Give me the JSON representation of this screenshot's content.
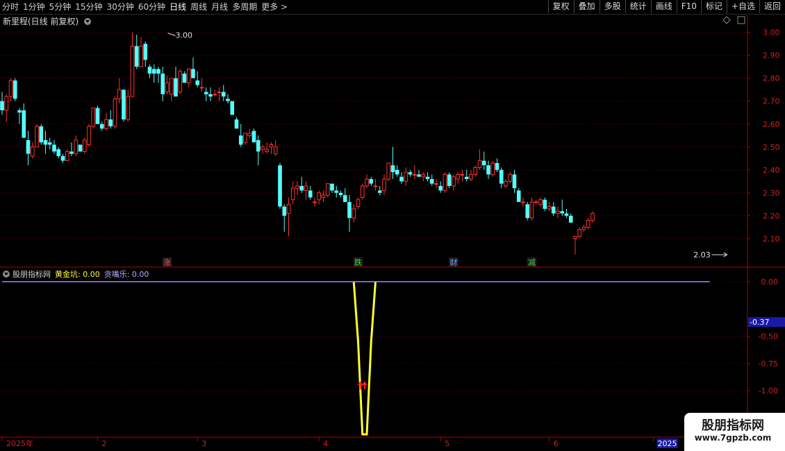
{
  "toolbar": {
    "periods": [
      "分时",
      "1分钟",
      "5分钟",
      "15分钟",
      "30分钟",
      "60分钟",
      "日线",
      "周线",
      "月线",
      "多周期",
      "更多"
    ],
    "active_period": "日线",
    "actions": [
      "复权",
      "叠加",
      "多股",
      "统计",
      "画线",
      "F10",
      "标记",
      "+自选",
      "返回"
    ]
  },
  "main_panel": {
    "title": "新里程(日线 前复权)"
  },
  "indicator_panel": {
    "name": "股朋指标网",
    "series1": "黄金坑: 0.00",
    "series2": "贪嘴乐: 0.00"
  },
  "colors": {
    "up": "#ff3232",
    "down": "#54ffff",
    "grid": "#7a0000",
    "axis": "#b00000",
    "line1": "#ffff33",
    "line2": "#9d8cff",
    "arrow": "#ff2020"
  },
  "chart_data": [
    {
      "type": "candlestick",
      "price_labels": [
        "3.00",
        "2.90",
        "2.80",
        "2.70",
        "2.60",
        "2.50",
        "2.40",
        "2.30",
        "2.20",
        "2.10"
      ],
      "ylim": [
        2.0,
        3.02
      ],
      "annotations": [
        {
          "text": "3.00",
          "index": 38,
          "price": 3.0
        },
        {
          "text": "2.03",
          "index": 167,
          "price": 2.03
        }
      ],
      "event_markers": [
        {
          "text": "涨",
          "index": 38,
          "color": "#ff5050"
        },
        {
          "text": "跌",
          "index": 82,
          "color": "#3fd43f"
        },
        {
          "text": "财",
          "index": 104,
          "color": "#6fa8ff"
        },
        {
          "text": "减",
          "index": 122,
          "color": "#3fd43f"
        }
      ],
      "ohlc": [
        [
          2.7,
          2.74,
          2.64,
          2.66
        ],
        [
          2.66,
          2.73,
          2.61,
          2.72
        ],
        [
          2.72,
          2.8,
          2.7,
          2.79
        ],
        [
          2.79,
          2.8,
          2.7,
          2.71
        ],
        [
          2.66,
          2.67,
          2.6,
          2.65
        ],
        [
          2.66,
          2.69,
          2.54,
          2.54
        ],
        [
          2.53,
          2.57,
          2.42,
          2.47
        ],
        [
          2.46,
          2.52,
          2.45,
          2.5
        ],
        [
          2.5,
          2.6,
          2.5,
          2.59
        ],
        [
          2.59,
          2.6,
          2.51,
          2.52
        ],
        [
          2.53,
          2.57,
          2.47,
          2.51
        ],
        [
          2.52,
          2.54,
          2.49,
          2.51
        ],
        [
          2.51,
          2.53,
          2.47,
          2.48
        ],
        [
          2.49,
          2.5,
          2.45,
          2.46
        ],
        [
          2.46,
          2.47,
          2.43,
          2.44
        ],
        [
          2.44,
          2.49,
          2.44,
          2.48
        ],
        [
          2.48,
          2.52,
          2.46,
          2.47
        ],
        [
          2.47,
          2.55,
          2.46,
          2.53
        ],
        [
          2.51,
          2.51,
          2.48,
          2.48
        ],
        [
          2.48,
          2.54,
          2.47,
          2.53
        ],
        [
          2.51,
          2.6,
          2.5,
          2.59
        ],
        [
          2.59,
          2.66,
          2.58,
          2.67
        ],
        [
          2.67,
          2.68,
          2.6,
          2.6
        ],
        [
          2.6,
          2.61,
          2.57,
          2.58
        ],
        [
          2.58,
          2.65,
          2.57,
          2.62
        ],
        [
          2.62,
          2.66,
          2.58,
          2.59
        ],
        [
          2.59,
          2.72,
          2.58,
          2.71
        ],
        [
          2.71,
          2.8,
          2.69,
          2.75
        ],
        [
          2.75,
          2.75,
          2.61,
          2.62
        ],
        [
          2.62,
          2.75,
          2.61,
          2.72
        ],
        [
          2.72,
          3.0,
          2.72,
          2.94
        ],
        [
          2.94,
          2.99,
          2.84,
          2.85
        ],
        [
          2.85,
          2.98,
          2.85,
          2.94
        ],
        [
          2.95,
          2.96,
          2.85,
          2.88
        ],
        [
          2.85,
          2.86,
          2.8,
          2.82
        ],
        [
          2.84,
          2.86,
          2.78,
          2.82
        ],
        [
          2.84,
          2.85,
          2.78,
          2.82
        ],
        [
          2.82,
          2.85,
          2.7,
          2.73
        ],
        [
          2.74,
          2.81,
          2.73,
          2.78
        ],
        [
          2.73,
          2.8,
          2.7,
          2.8
        ],
        [
          2.8,
          2.85,
          2.72,
          2.72
        ],
        [
          2.74,
          2.84,
          2.73,
          2.83
        ],
        [
          2.82,
          2.83,
          2.78,
          2.78
        ],
        [
          2.78,
          2.84,
          2.76,
          2.84
        ],
        [
          2.84,
          2.89,
          2.8,
          2.8
        ],
        [
          2.79,
          2.83,
          2.76,
          2.77
        ],
        [
          2.76,
          2.8,
          2.74,
          2.76
        ],
        [
          2.74,
          2.76,
          2.7,
          2.73
        ],
        [
          2.73,
          2.76,
          2.7,
          2.72
        ],
        [
          2.73,
          2.75,
          2.72,
          2.73
        ],
        [
          2.74,
          2.76,
          2.7,
          2.74
        ],
        [
          2.74,
          2.77,
          2.7,
          2.72
        ],
        [
          2.71,
          2.73,
          2.69,
          2.7
        ],
        [
          2.7,
          2.7,
          2.64,
          2.64
        ],
        [
          2.62,
          2.63,
          2.58,
          2.58
        ],
        [
          2.55,
          2.6,
          2.5,
          2.51
        ],
        [
          2.52,
          2.56,
          2.51,
          2.56
        ],
        [
          2.55,
          2.58,
          2.54,
          2.56
        ],
        [
          2.57,
          2.58,
          2.52,
          2.52
        ],
        [
          2.53,
          2.55,
          2.42,
          2.48
        ],
        [
          2.49,
          2.51,
          2.47,
          2.5
        ],
        [
          2.48,
          2.52,
          2.47,
          2.49
        ],
        [
          2.5,
          2.52,
          2.47,
          2.51
        ],
        [
          2.47,
          2.53,
          2.46,
          2.5
        ],
        [
          2.42,
          2.43,
          2.23,
          2.24
        ],
        [
          2.24,
          2.25,
          2.13,
          2.2
        ],
        [
          2.21,
          2.28,
          2.11,
          2.25
        ],
        [
          2.27,
          2.35,
          2.25,
          2.32
        ],
        [
          2.32,
          2.35,
          2.29,
          2.33
        ],
        [
          2.33,
          2.37,
          2.3,
          2.31
        ],
        [
          2.31,
          2.35,
          2.27,
          2.33
        ],
        [
          2.31,
          2.33,
          2.27,
          2.28
        ],
        [
          2.26,
          2.28,
          2.24,
          2.26
        ],
        [
          2.27,
          2.31,
          2.25,
          2.3
        ],
        [
          2.28,
          2.31,
          2.26,
          2.29
        ],
        [
          2.29,
          2.34,
          2.28,
          2.34
        ],
        [
          2.34,
          2.34,
          2.3,
          2.31
        ],
        [
          2.31,
          2.33,
          2.28,
          2.3
        ],
        [
          2.3,
          2.31,
          2.28,
          2.29
        ],
        [
          2.29,
          2.32,
          2.26,
          2.26
        ],
        [
          2.26,
          2.29,
          2.13,
          2.19
        ],
        [
          2.19,
          2.25,
          2.17,
          2.23
        ],
        [
          2.24,
          2.28,
          2.23,
          2.27
        ],
        [
          2.28,
          2.34,
          2.27,
          2.33
        ],
        [
          2.33,
          2.38,
          2.32,
          2.36
        ],
        [
          2.36,
          2.37,
          2.33,
          2.34
        ],
        [
          2.33,
          2.36,
          2.31,
          2.33
        ],
        [
          2.31,
          2.33,
          2.29,
          2.3
        ],
        [
          2.31,
          2.38,
          2.29,
          2.36
        ],
        [
          2.36,
          2.42,
          2.35,
          2.43
        ],
        [
          2.42,
          2.5,
          2.36,
          2.39
        ],
        [
          2.4,
          2.42,
          2.37,
          2.38
        ],
        [
          2.37,
          2.39,
          2.34,
          2.35
        ],
        [
          2.35,
          2.41,
          2.33,
          2.39
        ],
        [
          2.39,
          2.4,
          2.37,
          2.38
        ],
        [
          2.38,
          2.42,
          2.36,
          2.38
        ],
        [
          2.38,
          2.4,
          2.37,
          2.37
        ],
        [
          2.37,
          2.39,
          2.35,
          2.38
        ],
        [
          2.37,
          2.39,
          2.35,
          2.36
        ],
        [
          2.36,
          2.38,
          2.33,
          2.34
        ],
        [
          2.34,
          2.36,
          2.32,
          2.34
        ],
        [
          2.33,
          2.35,
          2.3,
          2.31
        ],
        [
          2.31,
          2.39,
          2.3,
          2.38
        ],
        [
          2.38,
          2.39,
          2.32,
          2.33
        ],
        [
          2.33,
          2.38,
          2.31,
          2.37
        ],
        [
          2.36,
          2.39,
          2.34,
          2.38
        ],
        [
          2.38,
          2.4,
          2.35,
          2.38
        ],
        [
          2.37,
          2.4,
          2.35,
          2.36
        ],
        [
          2.36,
          2.4,
          2.35,
          2.38
        ],
        [
          2.38,
          2.42,
          2.37,
          2.41
        ],
        [
          2.41,
          2.49,
          2.4,
          2.44
        ],
        [
          2.44,
          2.48,
          2.4,
          2.42
        ],
        [
          2.42,
          2.44,
          2.36,
          2.38
        ],
        [
          2.38,
          2.44,
          2.37,
          2.43
        ],
        [
          2.43,
          2.45,
          2.39,
          2.4
        ],
        [
          2.4,
          2.41,
          2.32,
          2.34
        ],
        [
          2.33,
          2.36,
          2.32,
          2.35
        ],
        [
          2.35,
          2.39,
          2.34,
          2.38
        ],
        [
          2.38,
          2.4,
          2.3,
          2.32
        ],
        [
          2.31,
          2.32,
          2.26,
          2.26
        ],
        [
          2.26,
          2.28,
          2.24,
          2.26
        ],
        [
          2.25,
          2.26,
          2.18,
          2.19
        ],
        [
          2.19,
          2.28,
          2.18,
          2.26
        ],
        [
          2.26,
          2.27,
          2.25,
          2.26
        ],
        [
          2.25,
          2.28,
          2.24,
          2.27
        ],
        [
          2.27,
          2.28,
          2.22,
          2.23
        ],
        [
          2.23,
          2.26,
          2.22,
          2.24
        ],
        [
          2.24,
          2.26,
          2.2,
          2.21
        ],
        [
          2.21,
          2.24,
          2.19,
          2.22
        ],
        [
          2.22,
          2.27,
          2.2,
          2.21
        ],
        [
          2.21,
          2.23,
          2.19,
          2.2
        ],
        [
          2.2,
          2.21,
          2.17,
          2.17
        ],
        [
          2.1,
          2.11,
          2.03,
          2.11
        ],
        [
          2.11,
          2.15,
          2.1,
          2.14
        ],
        [
          2.14,
          2.16,
          2.13,
          2.15
        ],
        [
          2.15,
          2.19,
          2.14,
          2.18
        ],
        [
          2.18,
          2.22,
          2.17,
          2.21
        ]
      ],
      "time_labels": [
        {
          "text": "2025年",
          "index": 0
        },
        {
          "text": "2",
          "index": 22
        },
        {
          "text": "3",
          "index": 45
        },
        {
          "text": "4",
          "index": 73
        },
        {
          "text": "5",
          "index": 101
        },
        {
          "text": "6",
          "index": 126
        },
        {
          "text": "2025",
          "index": 150
        }
      ]
    },
    {
      "type": "line",
      "name": "股朋指标网",
      "value_labels": [
        "0.00",
        "-0.37",
        "-0.50",
        "-0.75",
        "-1.00"
      ],
      "cursor_value": "-0.37",
      "ylim": [
        -1.4,
        0.0
      ],
      "series": [
        {
          "name": "黄金坑",
          "points": [
            [
              81,
              0.0
            ],
            [
              82,
              -0.55
            ],
            [
              83,
              -1.4
            ],
            [
              84,
              -1.4
            ],
            [
              85,
              -0.55
            ],
            [
              86,
              0.0
            ]
          ]
        },
        {
          "name": "贪嘴乐",
          "points": [
            [
              0,
              0.0
            ],
            [
              163,
              0.0
            ]
          ]
        }
      ],
      "arrows": [
        {
          "index": 82.5,
          "value": -0.95
        },
        {
          "index": 83.5,
          "value": -0.95
        }
      ]
    }
  ],
  "watermark": {
    "title": "股朋指标网",
    "url": "www.7gpzb.com"
  }
}
